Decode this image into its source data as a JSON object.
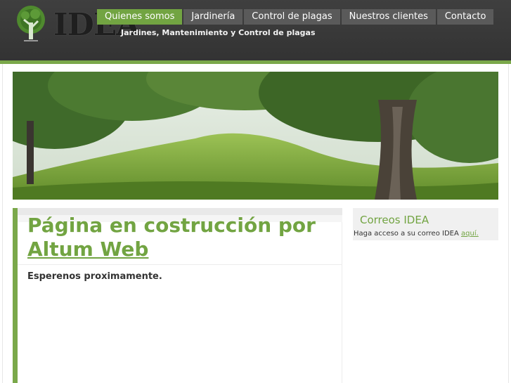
{
  "header": {
    "logo_text": "IDEA",
    "tagline": "Jardines, Mantenimiento y Control de plagas"
  },
  "nav": {
    "items": [
      {
        "label": "Quienes somos",
        "active": true
      },
      {
        "label": "Jardinería",
        "active": false
      },
      {
        "label": "Control de plagas",
        "active": false
      },
      {
        "label": "Nuestros clientes",
        "active": false
      },
      {
        "label": "Contacto",
        "active": false
      }
    ]
  },
  "main": {
    "title_text": "Página en costrucción por",
    "title_link": "Altum Web",
    "intro": "Esperenos proximamente."
  },
  "sidebar": {
    "title": "Correos IDEA",
    "text": "Haga acceso a su correo IDEA",
    "link": "aquí."
  },
  "colors": {
    "accent": "#72a442",
    "header_bg": "#3a3a3a",
    "nav_bg": "#5a5a5a"
  }
}
